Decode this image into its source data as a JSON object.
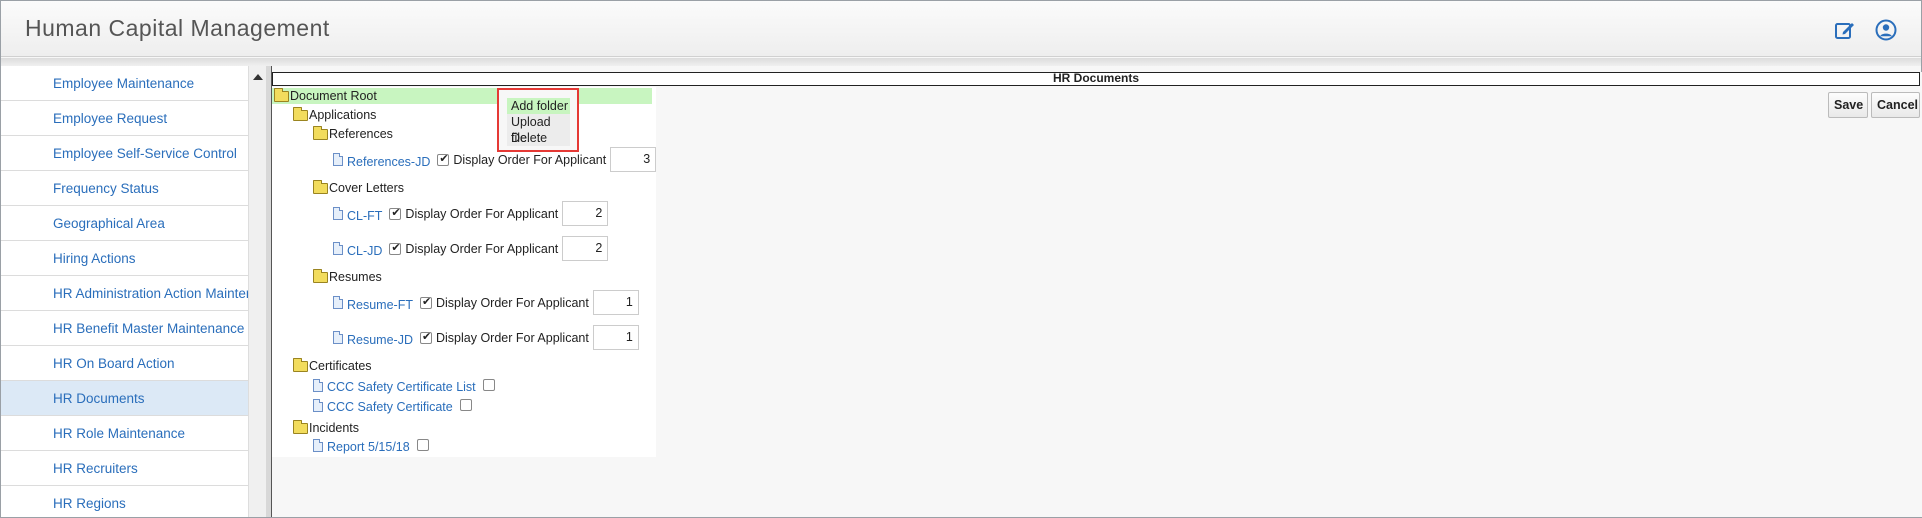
{
  "app": {
    "title": "Human Capital Management"
  },
  "header": {
    "edit_icon": "edit-icon",
    "user_icon": "user-circle-icon"
  },
  "sidebar": {
    "items": [
      {
        "label": "Employee Maintenance",
        "selected": false
      },
      {
        "label": "Employee Request",
        "selected": false
      },
      {
        "label": "Employee Self-Service Control",
        "selected": false
      },
      {
        "label": "Frequency Status",
        "selected": false
      },
      {
        "label": "Geographical Area",
        "selected": false
      },
      {
        "label": "Hiring Actions",
        "selected": false
      },
      {
        "label": "HR Administration Action Maintenance",
        "selected": false
      },
      {
        "label": "HR Benefit Master Maintenance",
        "selected": false
      },
      {
        "label": "HR On Board Action",
        "selected": false
      },
      {
        "label": "HR Documents",
        "selected": true
      },
      {
        "label": "HR Role Maintenance",
        "selected": false
      },
      {
        "label": "HR Recruiters",
        "selected": false
      },
      {
        "label": "HR Regions",
        "selected": false
      }
    ]
  },
  "panel": {
    "title": "HR Documents"
  },
  "tree": {
    "root": "Document Root",
    "applications": "Applications",
    "references": "References",
    "cover_letters": "Cover Letters",
    "resumes": "Resumes",
    "certificates": "Certificates",
    "incidents": "Incidents",
    "docs": {
      "references_jd": {
        "name": "References-JD",
        "checked": true,
        "order": "3"
      },
      "cl_ft": {
        "name": "CL-FT",
        "checked": true,
        "order": "2"
      },
      "cl_jd": {
        "name": "CL-JD",
        "checked": true,
        "order": "2"
      },
      "resume_ft": {
        "name": "Resume-FT",
        "checked": true,
        "order": "1"
      },
      "resume_jd": {
        "name": "Resume-JD",
        "checked": true,
        "order": "1"
      },
      "ccc_list": {
        "name": "CCC Safety Certificate List",
        "checked": false
      },
      "ccc_cert": {
        "name": "CCC Safety Certificate",
        "checked": false
      },
      "report": {
        "name": "Report 5/15/18",
        "checked": false
      }
    },
    "order_label": "Display Order For Applicant"
  },
  "context_menu": {
    "items": [
      "Add folder",
      "Upload file",
      "Delete"
    ]
  },
  "buttons": {
    "save": "Save",
    "cancel": "Cancel"
  },
  "colors": {
    "accent": "#2a6ebb",
    "highlight": "#c8f5c0",
    "selected": "#dce9f6",
    "menu_border": "#e53935"
  }
}
